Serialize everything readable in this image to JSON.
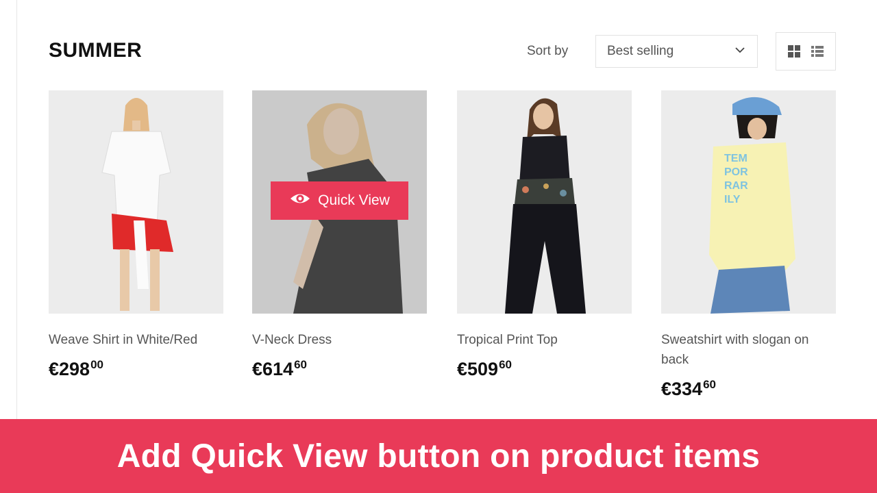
{
  "collection": {
    "title": "SUMMER"
  },
  "toolbar": {
    "sort_label": "Sort by",
    "sort_value": "Best selling",
    "grid_icon": "grid-view-icon",
    "list_icon": "list-view-icon"
  },
  "products": [
    {
      "name": "Weave Shirt in White/Red",
      "price_main": "€298",
      "price_cents": "00",
      "quick_view": false
    },
    {
      "name": "V-Neck Dress",
      "price_main": "€614",
      "price_cents": "60",
      "quick_view": true
    },
    {
      "name": "Tropical Print Top",
      "price_main": "€509",
      "price_cents": "60",
      "quick_view": false
    },
    {
      "name": "Sweatshirt with slogan on back",
      "price_main": "€334",
      "price_cents": "60",
      "quick_view": false
    }
  ],
  "quick_view": {
    "label": "Quick View",
    "icon": "eye-icon"
  },
  "banner": {
    "text": "Add Quick View button on product items"
  },
  "colors": {
    "accent": "#e93a58",
    "text": "#111111",
    "muted": "#555555",
    "border": "#e2e2e2"
  }
}
